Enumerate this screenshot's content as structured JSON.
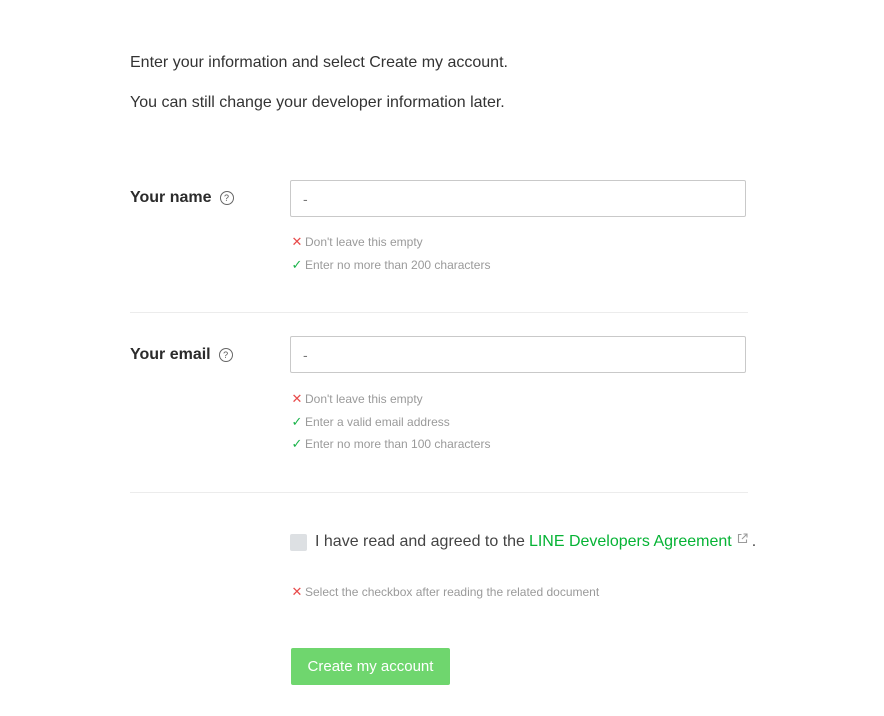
{
  "intro": {
    "line1": "Enter your information and select Create my account.",
    "line2": "You can still change your developer information later."
  },
  "name_field": {
    "label": "Your name",
    "help_icon": "question-circle-icon",
    "value": "-",
    "rules": [
      {
        "status": "error",
        "text": "Don't leave this empty"
      },
      {
        "status": "ok",
        "text": "Enter no more than 200 characters"
      }
    ]
  },
  "email_field": {
    "label": "Your email",
    "help_icon": "question-circle-icon",
    "value": "-",
    "rules": [
      {
        "status": "error",
        "text": "Don't leave this empty"
      },
      {
        "status": "ok",
        "text": "Enter a valid email address"
      },
      {
        "status": "ok",
        "text": "Enter no more than 100 characters"
      }
    ]
  },
  "agreement": {
    "prefix": "I have read and agreed to the",
    "link_text": "LINE Developers Agreement",
    "suffix": ".",
    "checked": false,
    "error": "Select the checkbox after reading the related document"
  },
  "submit": {
    "label": "Create my account"
  },
  "colors": {
    "accent_green": "#06b335",
    "button_green": "#6fd66e",
    "error_red": "#e84a4a",
    "ok_green": "#1ab34a"
  }
}
